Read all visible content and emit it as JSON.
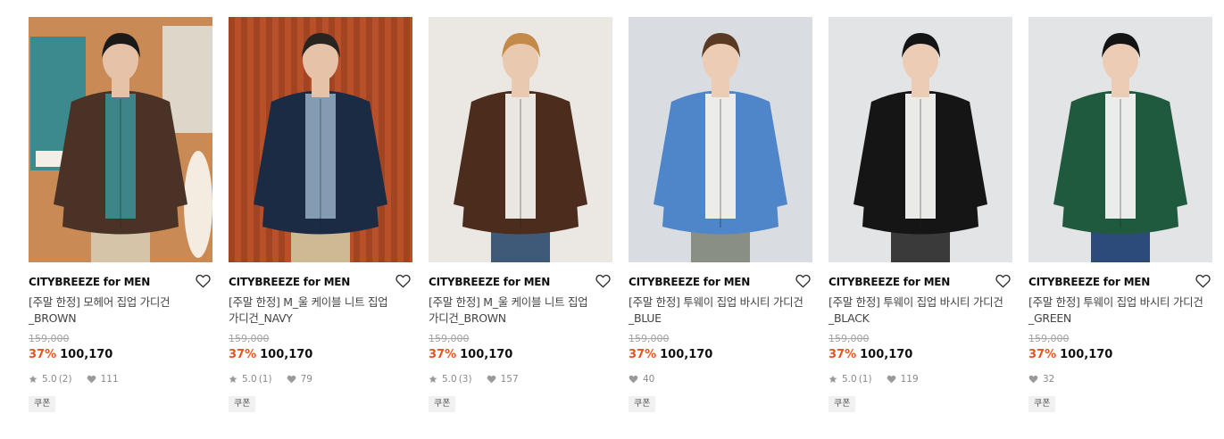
{
  "products": [
    {
      "brand": "CITYBREEZE for MEN",
      "title": "[주말 한정] 모헤어 집업 가디건 _BROWN",
      "original_price": "159,000",
      "discount": "37%",
      "price": "100,170",
      "rating": "5.0",
      "review_count": "(2)",
      "likes": "111",
      "coupon": "쿠폰",
      "image": {
        "bg": "#c98a55",
        "garment": "#4a3326",
        "pants": "#d6c4a8",
        "accent": "#3d8a8e",
        "skin": "#e6c3a8",
        "hair": "#1c1a18"
      }
    },
    {
      "brand": "CITYBREEZE for MEN",
      "title": "[주말 한정] M_울 케이블 니트 집업 가디건_NAVY",
      "original_price": "159,000",
      "discount": "37%",
      "price": "100,170",
      "rating": "5.0",
      "review_count": "(1)",
      "likes": "79",
      "coupon": "쿠폰",
      "image": {
        "bg": "#b8502a",
        "garment": "#1c2b44",
        "pants": "#cdb994",
        "accent": "#8aa2b8",
        "skin": "#e6c3a8",
        "hair": "#2a2420"
      }
    },
    {
      "brand": "CITYBREEZE for MEN",
      "title": "[주말 한정] M_울 케이블 니트 집업 가디건_BROWN",
      "original_price": "159,000",
      "discount": "37%",
      "price": "100,170",
      "rating": "5.0",
      "review_count": "(3)",
      "likes": "157",
      "coupon": "쿠폰",
      "image": {
        "bg": "#ebe8e4",
        "garment": "#4c2c1d",
        "pants": "#3e5a78",
        "accent": "#f2f0ec",
        "skin": "#e9c9b0",
        "hair": "#c48a4a"
      }
    },
    {
      "brand": "CITYBREEZE for MEN",
      "title": "[주말 한정] 투웨이 집업 바시티 가디건 _BLUE",
      "original_price": "159,000",
      "discount": "37%",
      "price": "100,170",
      "rating": "",
      "review_count": "",
      "likes": "40",
      "coupon": "쿠폰",
      "image": {
        "bg": "#d9dde2",
        "garment": "#4f86c9",
        "pants": "#8a8f86",
        "accent": "#f4f1ec",
        "skin": "#ecccb4",
        "hair": "#5a3a24"
      }
    },
    {
      "brand": "CITYBREEZE for MEN",
      "title": "[주말 한정] 투웨이 집업 바시티 가디건 _BLACK",
      "original_price": "159,000",
      "discount": "37%",
      "price": "100,170",
      "rating": "5.0",
      "review_count": "(1)",
      "likes": "119",
      "coupon": "쿠폰",
      "image": {
        "bg": "#e3e4e6",
        "garment": "#151515",
        "pants": "#3a3a3a",
        "accent": "#f6f6f4",
        "skin": "#ecccb4",
        "hair": "#141414"
      }
    },
    {
      "brand": "CITYBREEZE for MEN",
      "title": "[주말 한정] 투웨이 집업 바시티 가디건 _GREEN",
      "original_price": "159,000",
      "discount": "37%",
      "price": "100,170",
      "rating": "",
      "review_count": "",
      "likes": "32",
      "coupon": "쿠폰",
      "image": {
        "bg": "#e3e4e6",
        "garment": "#1f5a3e",
        "pants": "#2c4a7a",
        "accent": "#f6f6f4",
        "skin": "#ecccb4",
        "hair": "#141414"
      }
    }
  ],
  "colors": {
    "discount": "#e8531d",
    "meta": "#8a8a8a"
  },
  "icons": {
    "like": "heart-outline-icon",
    "star": "star-icon",
    "heart": "heart-icon"
  }
}
